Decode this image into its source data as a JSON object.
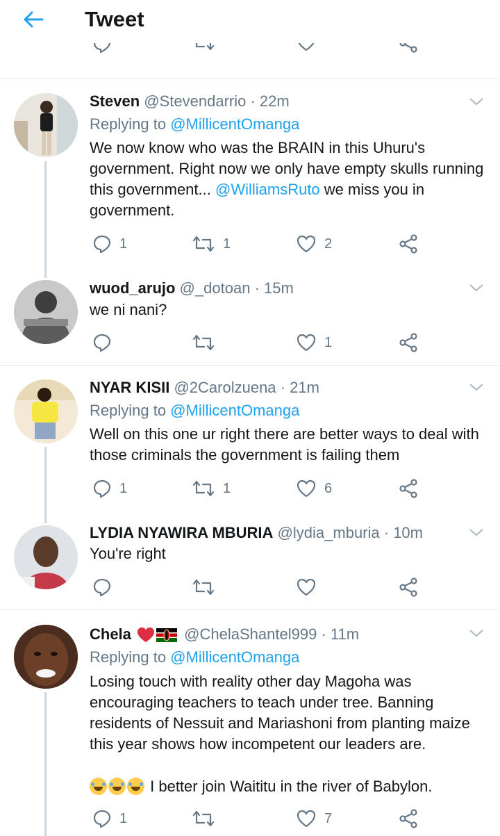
{
  "header": {
    "title": "Tweet"
  },
  "tweets": [
    {
      "name": "Steven",
      "handle": "@Stevendarrio",
      "time": "· 22m",
      "replying_prefix": "Replying to",
      "replying_to": "@MillicentOmanga",
      "text_a": "We now know who was the BRAIN in this Uhuru's government. Right now we only have empty skulls running this government... ",
      "mention": "@WilliamsRuto",
      "text_b": " we miss you in government.",
      "replies": "1",
      "retweets": "1",
      "likes": "2"
    },
    {
      "name": "wuod_arujo",
      "handle": "@_dotoan",
      "time": "· 15m",
      "text": "we ni nani?",
      "replies": "",
      "retweets": "",
      "likes": "1"
    },
    {
      "name": "NYAR KISII",
      "handle": "@2Carolzuena",
      "time": "· 21m",
      "replying_prefix": "Replying to",
      "replying_to": "@MillicentOmanga",
      "text": "Well on this one ur right there are better ways to deal with those criminals the government is failing them",
      "replies": "1",
      "retweets": "1",
      "likes": "6"
    },
    {
      "name": "LYDIA NYAWIRA MBURIA",
      "handle": "@lydia_mburia",
      "time": "· 10m",
      "text": "You're right",
      "replies": "",
      "retweets": "",
      "likes": ""
    },
    {
      "name": "Chela",
      "handle": "@ChelaShantel999",
      "time": "· 11m",
      "replying_prefix": "Replying to",
      "replying_to": "@MillicentOmanga",
      "text": "Losing touch with reality other day Magoha was encouraging teachers to teach under tree. Banning residents of Nessuit and Mariashoni from planting maize this year shows how incompetent our leaders are.",
      "text_line2": "I better join Waititu in the river of Babylon.",
      "replies": "1",
      "retweets": "",
      "likes": "7"
    }
  ],
  "colors": {
    "accent": "#1da1f2",
    "secondary_text": "#657786",
    "divider": "#e1e8ed",
    "icon": "#657786"
  }
}
